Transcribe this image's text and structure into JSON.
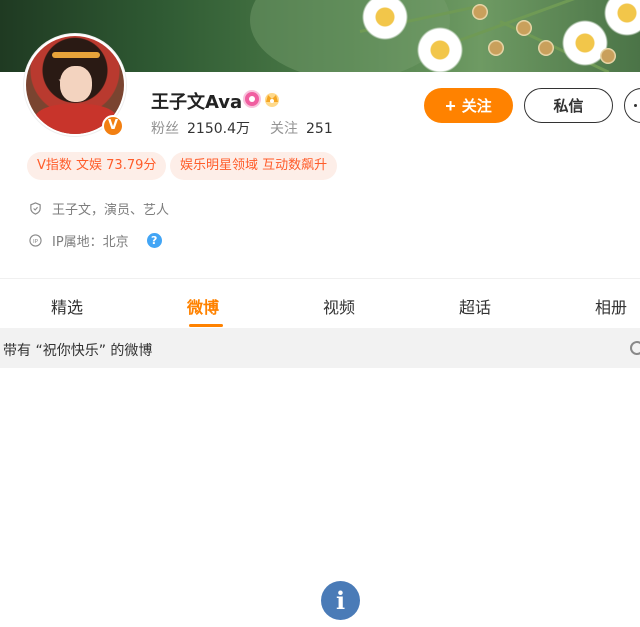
{
  "colors": {
    "accent": "#ff8200",
    "tag_text": "#ff5c2a",
    "tag_bg": "#fdeee8",
    "info_fab": "#4a7bb7"
  },
  "profile": {
    "name": "王子文Ava",
    "verified_badge": "V",
    "fans_label": "粉丝",
    "fans_count": "2150.4万",
    "following_label": "关注",
    "following_count": "251"
  },
  "actions": {
    "follow_label": "关注",
    "follow_icon": "+",
    "message_label": "私信"
  },
  "tags": [
    {
      "label": "V指数 文娱 73.79分"
    },
    {
      "label": "娱乐明星领域 互动数飙升"
    }
  ],
  "info": {
    "identity": "王子文，演员、艺人",
    "ip_location": "IP属地：北京",
    "help_icon": "?"
  },
  "tabs": [
    {
      "label": "精选",
      "active": false
    },
    {
      "label": "微博",
      "active": true
    },
    {
      "label": "视频",
      "active": false
    },
    {
      "label": "超话",
      "active": false
    },
    {
      "label": "相册",
      "active": false
    }
  ],
  "filter": {
    "text": "带有 “祝你快乐” 的微博"
  },
  "fab": {
    "icon": "i"
  }
}
